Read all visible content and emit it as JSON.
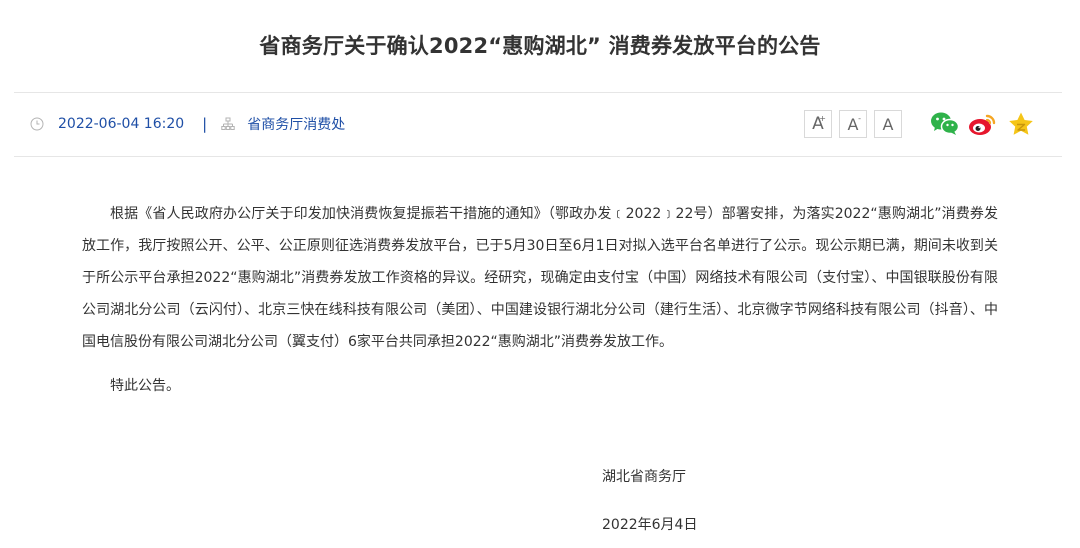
{
  "article": {
    "title": "省商务厅关于确认2022“惠购湖北” 消费券发放平台的公告",
    "meta": {
      "datetime": "2022-06-04 16:20",
      "separator": "|",
      "source": "省商务厅消费处"
    },
    "body": {
      "paragraph": "根据《省人民政府办公厅关于印发加快消费恢复提振若干措施的通知》（鄂政办发﹝2022﹞22号）部署安排，为落实2022“惠购湖北”消费券发放工作，我厅按照公开、公平、公正原则征选消费券发放平台，已于5月30日至6月1日对拟入选平台名单进行了公示。现公示期已满，期间未收到关于所公示平台承担2022“惠购湖北”消费券发放工作资格的异议。经研究，现确定由支付宝（中国）网络技术有限公司（支付宝）、中国银联股份有限公司湖北分公司（云闪付）、北京三快在线科技有限公司（美团）、中国建设银行湖北分公司（建行生活）、北京微字节网络科技有限公司（抖音）、中国电信股份有限公司湖北分公司（翼支付）6家平台共同承担2022“惠购湖北”消费券发放工作。",
      "closing": "特此公告。"
    },
    "signature": {
      "org": "湖北省商务厅",
      "date": "2022年6月4日"
    }
  },
  "toolbar": {
    "font_buttons": [
      {
        "label": "A",
        "sup": "+"
      },
      {
        "label": "A",
        "sup": "-"
      },
      {
        "label": "A",
        "sup": ""
      }
    ],
    "share_icons": [
      "wechat-icon",
      "weibo-icon",
      "favorite-star-icon"
    ]
  },
  "colors": {
    "meta_text": "#1f4fa6",
    "wechat": "#2fb24a",
    "weibo": "#e6162d",
    "weibo_accent": "#f5a623",
    "star": "#f5c518",
    "rule": "#e6e6e6"
  }
}
